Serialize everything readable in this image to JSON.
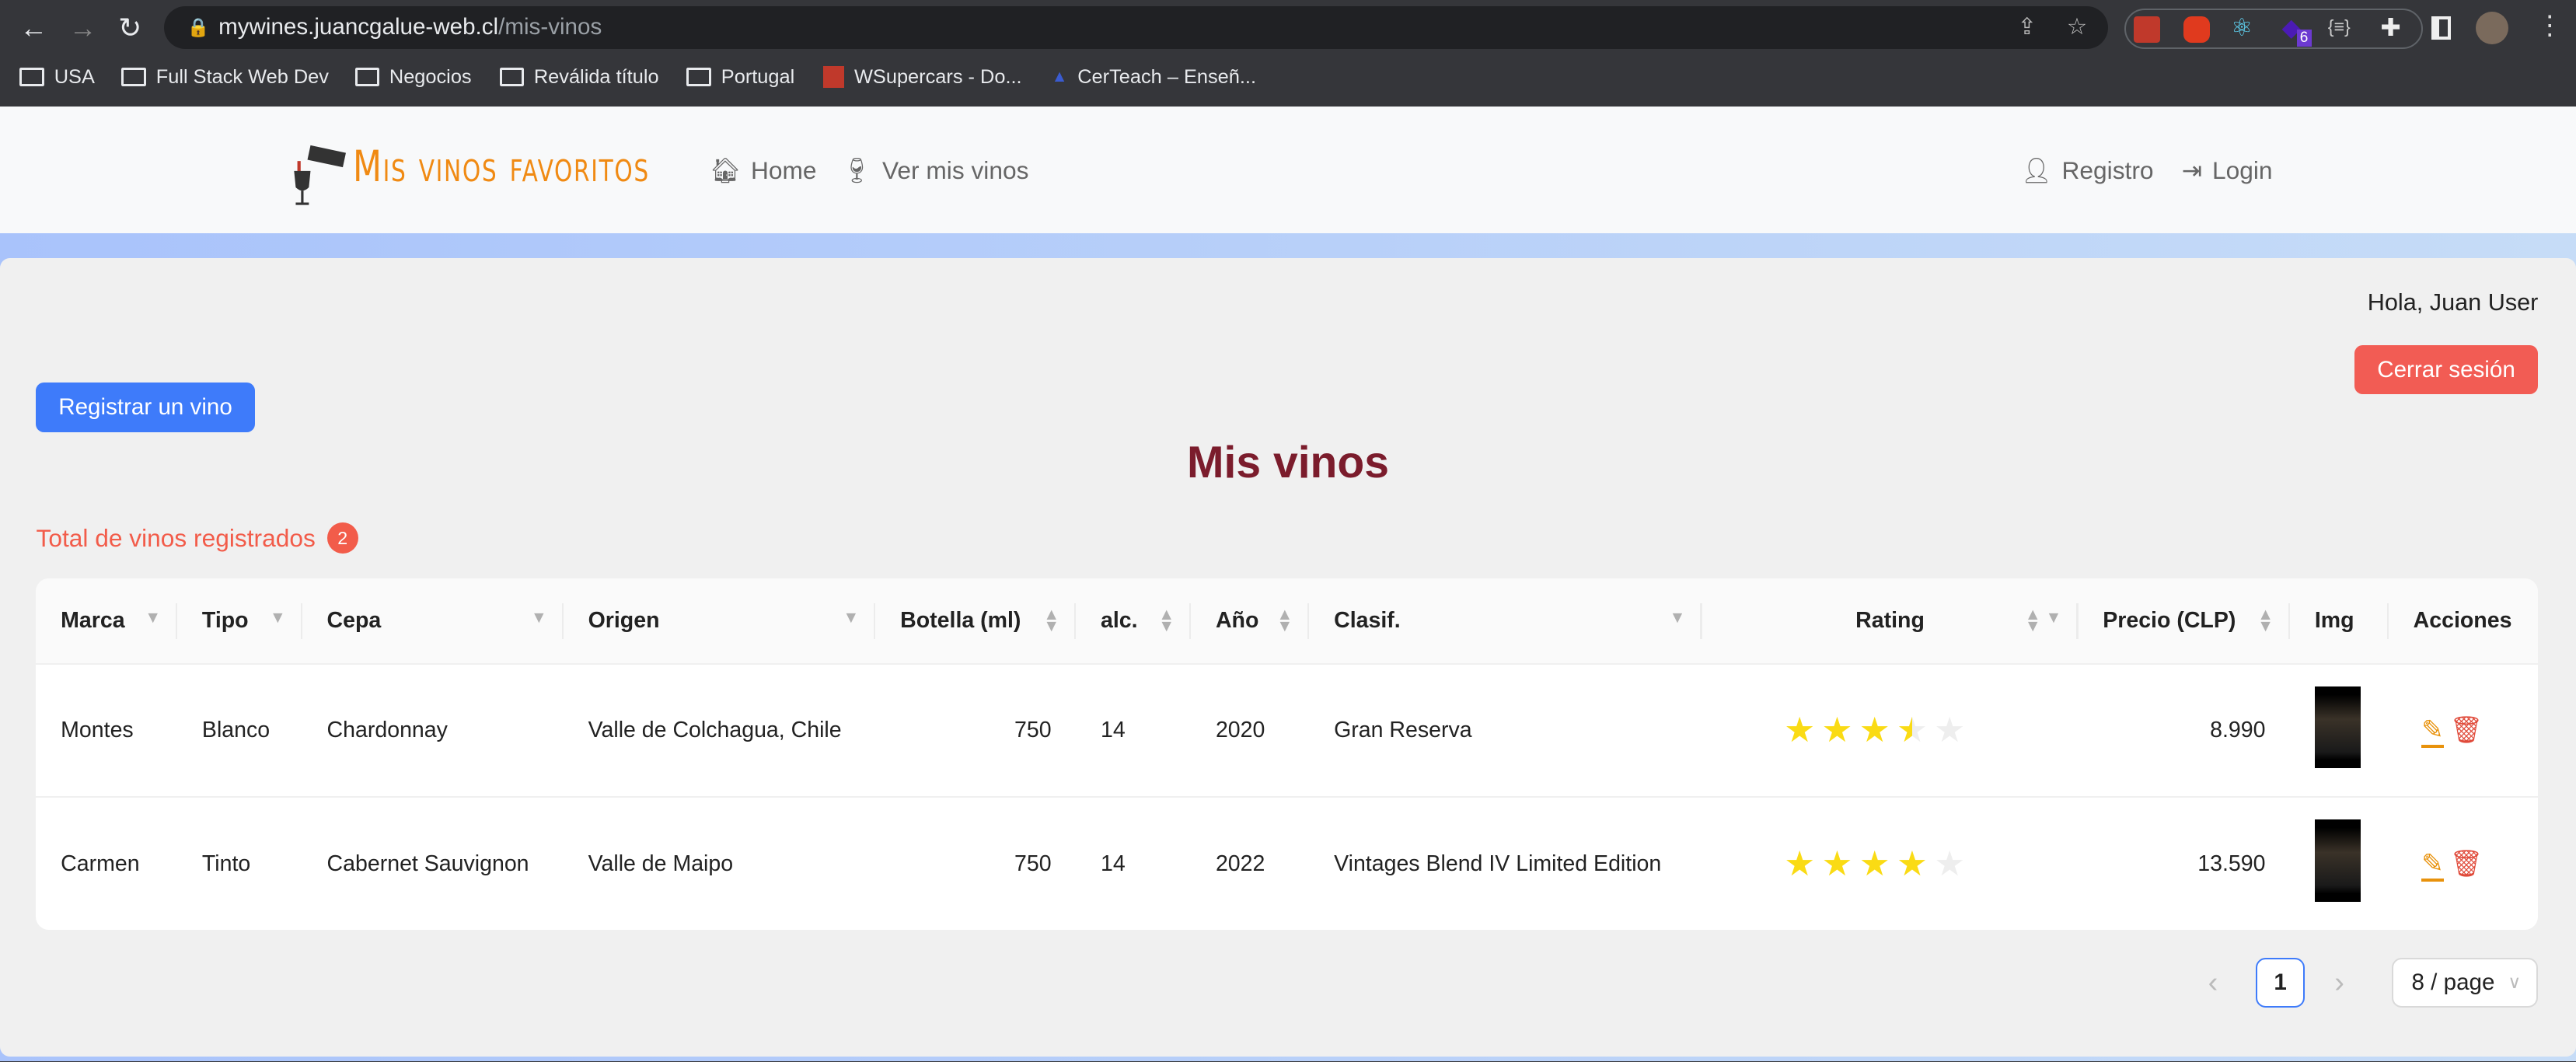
{
  "browser": {
    "url_host": "mywines.juancgalue-web.cl",
    "url_path": "/mis-vinos",
    "extension_badge": "6",
    "bookmarks": [
      "USA",
      "Full Stack Web Dev",
      "Negocios",
      "Reválida título",
      "Portugal",
      "WSupercars - Do...",
      "CerTeach – Enseñ..."
    ]
  },
  "navbar": {
    "brand": "Mis vinos favoritos",
    "home": "Home",
    "ver": "Ver mis vinos",
    "registro": "Registro",
    "login": "Login"
  },
  "main": {
    "greeting": "Hola, Juan User",
    "logout": "Cerrar sesión",
    "register_wine": "Registrar un vino",
    "title": "Mis vinos",
    "total_label": "Total de vinos registrados",
    "total_count": "2"
  },
  "table": {
    "headers": [
      "Marca",
      "Tipo",
      "Cepa",
      "Origen",
      "Botella (ml)",
      "alc.",
      "Año",
      "Clasif.",
      "Rating",
      "Precio (CLP)",
      "Img",
      "Acciones"
    ],
    "rows": [
      {
        "marca": "Montes",
        "tipo": "Blanco",
        "cepa": "Chardonnay",
        "origen": "Valle de Colchagua, Chile",
        "botella": "750",
        "alc": "14",
        "anio": "2020",
        "clasif": "Gran Reserva",
        "rating": 3.5,
        "precio": "8.990"
      },
      {
        "marca": "Carmen",
        "tipo": "Tinto",
        "cepa": "Cabernet Sauvignon",
        "origen": "Valle de Maipo",
        "botella": "750",
        "alc": "14",
        "anio": "2022",
        "clasif": "Vintages Blend IV Limited Edition",
        "rating": 4,
        "precio": "13.590"
      }
    ]
  },
  "pagination": {
    "page": "1",
    "page_size": "8 / page",
    "prev": "‹",
    "next": "›"
  },
  "colors": {
    "brand": "#f08a13",
    "title": "#7b1c2c",
    "primary": "#3e7bfa",
    "danger": "#f25c54",
    "star": "#fadb14"
  }
}
